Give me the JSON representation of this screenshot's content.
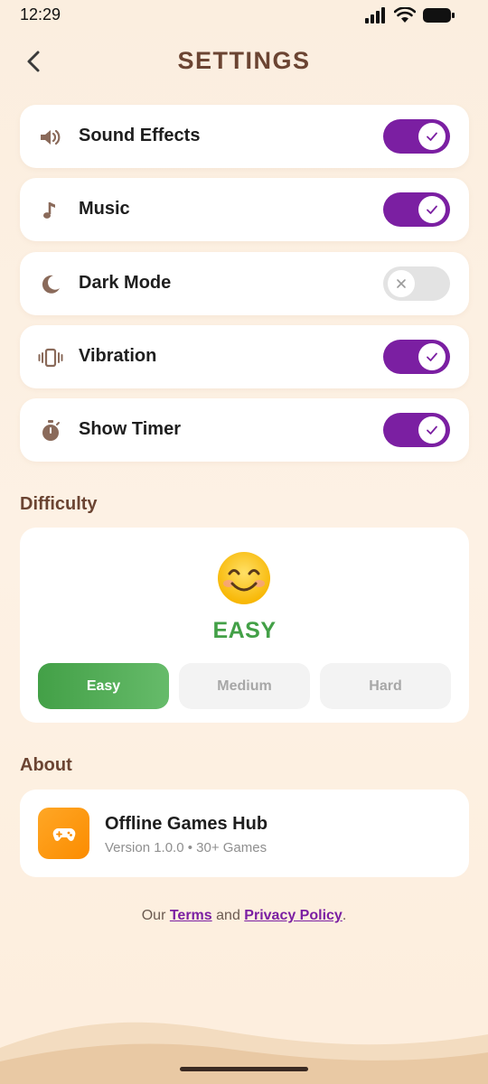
{
  "status_bar": {
    "time": "12:29"
  },
  "header": {
    "title": "SETTINGS"
  },
  "settings": [
    {
      "label": "Sound Effects",
      "icon": "speaker-icon",
      "enabled": true
    },
    {
      "label": "Music",
      "icon": "music-note-icon",
      "enabled": true
    },
    {
      "label": "Dark Mode",
      "icon": "moon-icon",
      "enabled": false
    },
    {
      "label": "Vibration",
      "icon": "vibration-icon",
      "enabled": true
    },
    {
      "label": "Show Timer",
      "icon": "stopwatch-icon",
      "enabled": true
    }
  ],
  "difficulty": {
    "section_title": "Difficulty",
    "current": "EASY",
    "emoji": "smiling-face-icon",
    "options": [
      "Easy",
      "Medium",
      "Hard"
    ],
    "selected": "Easy"
  },
  "about": {
    "section_title": "About",
    "app_name": "Offline Games Hub",
    "version": "Version 1.0.0 • 30+ Games",
    "icon": "gamepad-icon"
  },
  "footer": {
    "prefix": "Our",
    "terms": "Terms",
    "and": "and",
    "privacy": "Privacy Policy",
    "suffix": "."
  },
  "colors": {
    "accent": "#7b1fa2",
    "title_brown": "#6b4432",
    "easy_green": "#43a047",
    "app_icon_orange": "#fb8c00",
    "background": "#fdf1e4"
  }
}
